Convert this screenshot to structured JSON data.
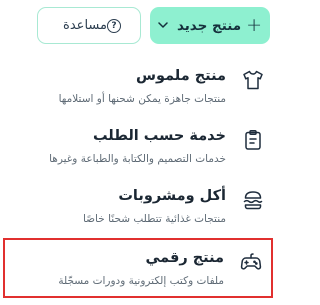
{
  "header": {
    "new_product_label": "منتج جديد",
    "plus_symbol": "+",
    "help_label": "مساعدة",
    "help_icon_symbol": "?"
  },
  "menu": {
    "items": [
      {
        "title": "منتج ملموس",
        "description": "منتجات جاهزة يمكن شحنها أو استلامها",
        "icon": "tshirt-icon"
      },
      {
        "title": "خدمة حسب الطلب",
        "description": "خدمات التصميم والكتابة والطباعة وغيرها",
        "icon": "clipboard-list-icon"
      },
      {
        "title": "أكل ومشروبات",
        "description": "منتجات غذائية تتطلب شحنًا خاصًا",
        "icon": "burger-icon"
      },
      {
        "title": "منتج رقمي",
        "description": "ملفات وكتب إلكترونية ودورات مسجّلة",
        "icon": "gamepad-icon",
        "selected": true
      }
    ]
  },
  "colors": {
    "primary_button": "#8ef0d0",
    "secondary_border": "#a8e9d3",
    "selection_border": "#e1302f",
    "text": "#1b2733",
    "muted_text": "#5e6a75"
  }
}
